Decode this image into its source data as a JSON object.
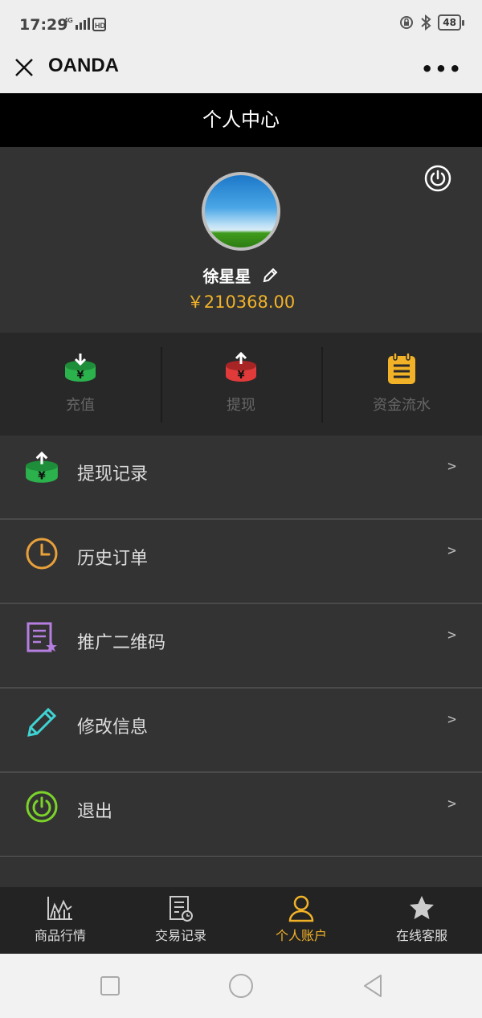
{
  "status_bar": {
    "time": "17:29",
    "network": "4G HD",
    "battery": "48"
  },
  "nav_bar": {
    "title": "OANDA",
    "more": "•••"
  },
  "page_header": {
    "title": "个人中心"
  },
  "profile": {
    "name": "徐星星",
    "balance": "￥210368.00"
  },
  "quick_actions": [
    {
      "label": "充值",
      "icon": "deposit-icon",
      "color": "#2bb24c"
    },
    {
      "label": "提现",
      "icon": "withdraw-icon",
      "color": "#e03a3a"
    },
    {
      "label": "资金流水",
      "icon": "ledger-icon",
      "color": "#f1b228"
    }
  ],
  "menu": [
    {
      "label": "提现记录",
      "icon": "withdraw-record-icon",
      "arrow": ">"
    },
    {
      "label": "历史订单",
      "icon": "clock-icon",
      "arrow": ">"
    },
    {
      "label": "推广二维码",
      "icon": "document-star-icon",
      "arrow": ">"
    },
    {
      "label": "修改信息",
      "icon": "pencil-icon",
      "arrow": ">"
    },
    {
      "label": "退出",
      "icon": "power-icon",
      "arrow": ">"
    }
  ],
  "tab_bar": [
    {
      "label": "商品行情",
      "icon": "chart-icon",
      "active": false
    },
    {
      "label": "交易记录",
      "icon": "record-icon",
      "active": false
    },
    {
      "label": "个人账户",
      "icon": "user-icon",
      "active": true
    },
    {
      "label": "在线客服",
      "icon": "star-icon",
      "active": false
    }
  ],
  "colors": {
    "accent": "#f1b228",
    "header_bg": "#000000",
    "panel_bg": "#333333"
  }
}
